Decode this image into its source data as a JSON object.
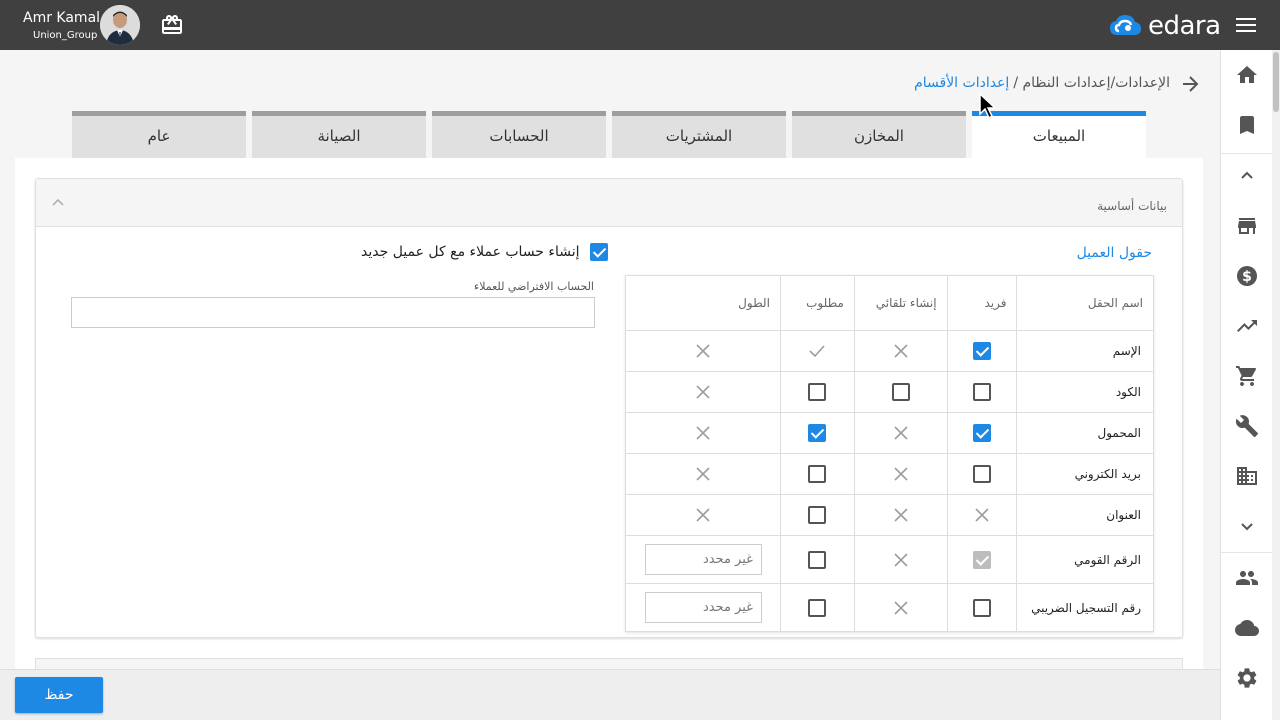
{
  "header": {
    "user_name": "Amr Kamal",
    "company": "Union_Group",
    "brand": "edara"
  },
  "breadcrumb": {
    "parent": "الإعدادات/إعدادات النظام /",
    "current": "إعدادات الأقسام"
  },
  "tabs": [
    {
      "label": "المبيعات",
      "active": true
    },
    {
      "label": "المخازن",
      "active": false
    },
    {
      "label": "المشتريات",
      "active": false
    },
    {
      "label": "الحسابات",
      "active": false
    },
    {
      "label": "الصيانة",
      "active": false
    },
    {
      "label": "عام",
      "active": false
    }
  ],
  "card": {
    "title": "بيانات أساسية",
    "section_title": "حقول العميل",
    "create_account_label": "إنشاء حساب عملاء مع كل عميل جديد",
    "default_account_label": "الحساب الافتراضي للعملاء"
  },
  "table": {
    "headers": {
      "name": "اسم الحقل",
      "unique": "فريد",
      "auto": "إنشاء تلقائي",
      "required": "مطلوب",
      "length": "الطول"
    },
    "rows": [
      {
        "name": "الإسم",
        "unique": "checked",
        "auto": "x",
        "required": "tick",
        "length": "x"
      },
      {
        "name": "الكود",
        "unique": "empty",
        "auto": "empty",
        "required": "empty",
        "length": "x"
      },
      {
        "name": "المحمول",
        "unique": "checked",
        "auto": "x",
        "required": "checked",
        "length": "x"
      },
      {
        "name": "بريد الكتروني",
        "unique": "empty",
        "auto": "x",
        "required": "empty",
        "length": "x"
      },
      {
        "name": "العنوان",
        "unique": "x",
        "auto": "x",
        "required": "empty",
        "length": "x"
      },
      {
        "name": "الرقم القومي",
        "unique": "disabled",
        "auto": "x",
        "required": "empty",
        "length": "input"
      },
      {
        "name": "رقم التسجيل الضريبي",
        "unique": "empty",
        "auto": "x",
        "required": "empty",
        "length": "input"
      }
    ],
    "length_placeholder": "غير محدد"
  },
  "footer": {
    "save_label": "حفظ"
  },
  "colors": {
    "accent": "#1e88e5",
    "topbar": "#404040"
  },
  "sidenav_icons": [
    "home-icon",
    "bookmark-icon",
    "chevron-up-icon",
    "store-icon",
    "dollar-icon",
    "trending-up-icon",
    "cart-icon",
    "wrench-icon",
    "building-icon",
    "chevron-down-icon",
    "people-icon",
    "cloud-icon",
    "gear-icon"
  ]
}
